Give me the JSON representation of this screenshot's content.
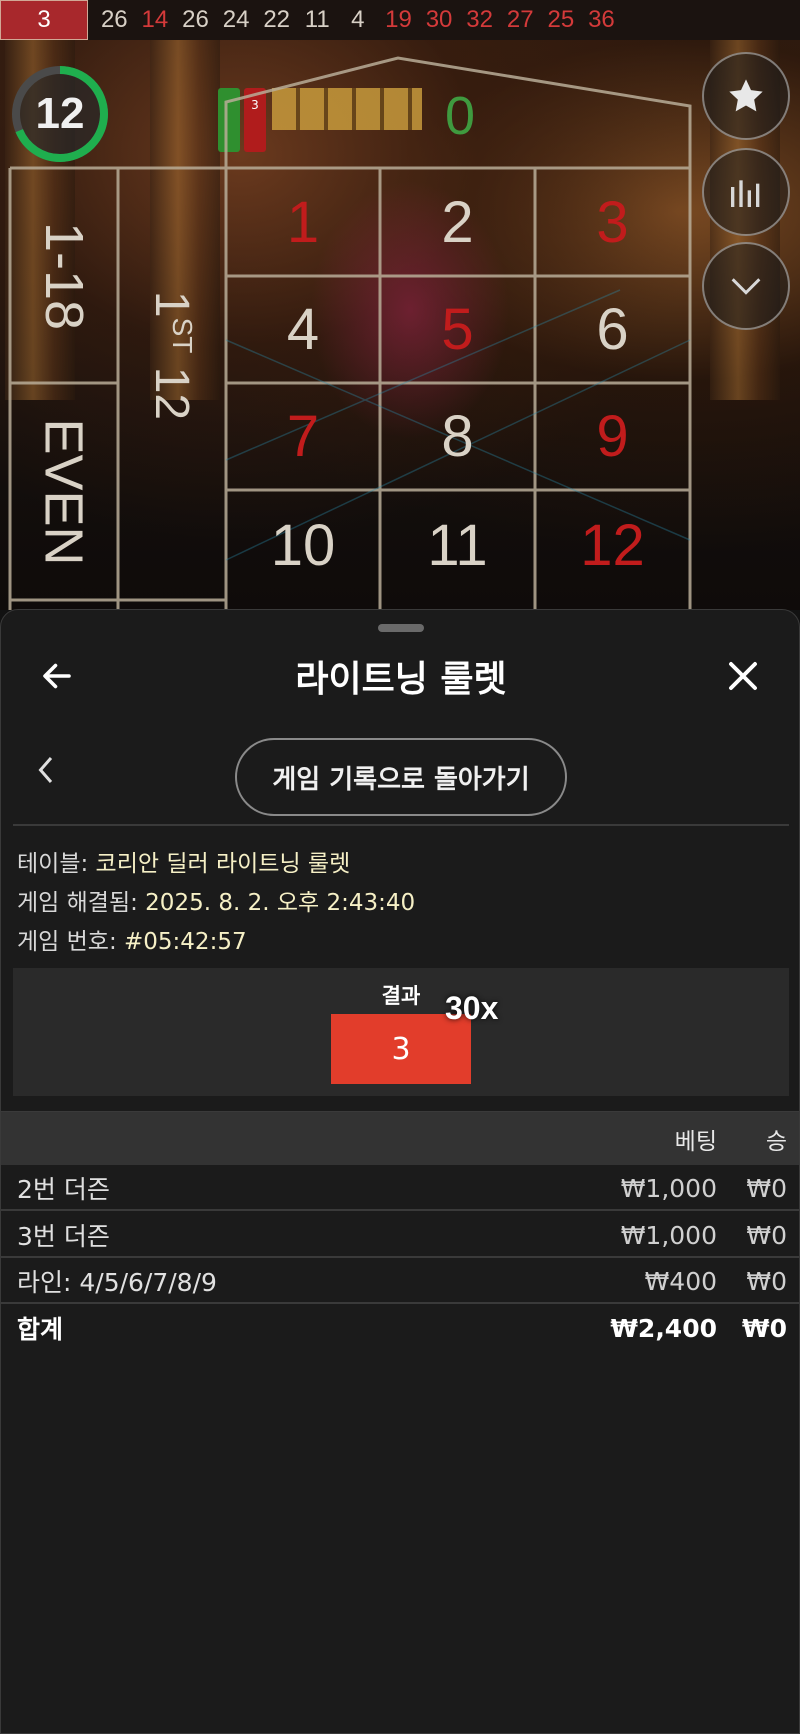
{
  "history": {
    "numbers": [
      {
        "value": "3",
        "color": "red"
      },
      {
        "value": "26",
        "color": "black"
      },
      {
        "value": "14",
        "color": "red"
      },
      {
        "value": "26",
        "color": "black"
      },
      {
        "value": "24",
        "color": "black"
      },
      {
        "value": "22",
        "color": "black"
      },
      {
        "value": "11",
        "color": "black"
      },
      {
        "value": "4",
        "color": "black"
      },
      {
        "value": "19",
        "color": "red"
      },
      {
        "value": "30",
        "color": "red"
      },
      {
        "value": "32",
        "color": "red"
      },
      {
        "value": "27",
        "color": "red"
      },
      {
        "value": "25",
        "color": "red"
      },
      {
        "value": "36",
        "color": "red"
      }
    ]
  },
  "game": {
    "timer": "12",
    "zero": "0",
    "mini_result": "3",
    "outside": {
      "low": "1-18",
      "even": "EVEN",
      "dozen_main": "1",
      "dozen_sup": "ST",
      "dozen_num": "12"
    },
    "grid": [
      [
        "1",
        "2",
        "3"
      ],
      [
        "4",
        "5",
        "6"
      ],
      [
        "7",
        "8",
        "9"
      ],
      [
        "10",
        "11",
        "12"
      ]
    ],
    "red_numbers": [
      "1",
      "3",
      "5",
      "7",
      "9",
      "12"
    ],
    "colors": {
      "red": "#c11c1c",
      "green": "#3f9a3f",
      "timer_ring": "#1fae4e"
    }
  },
  "sheet": {
    "title": "라이트닝 룰렛",
    "back_to_history": "게임 기록으로 돌아가기",
    "info": {
      "table_label": "테이블: ",
      "table_value": "코리안 딜러 라이트닝 룰렛",
      "resolved_label": "게임 해결됨: ",
      "resolved_value": "2025. 8. 2. 오후 2:43:40",
      "game_no_label": "게임 번호: ",
      "game_no_value": "#05:42:57"
    },
    "result": {
      "label": "결과",
      "number": "3",
      "multiplier": "30x",
      "color": "#e23d2b"
    },
    "table": {
      "headers": {
        "bet": "베팅",
        "win": "승"
      },
      "rows": [
        {
          "name": "2번 더즌",
          "bet": "₩1,000",
          "win": "₩0"
        },
        {
          "name": "3번 더즌",
          "bet": "₩1,000",
          "win": "₩0"
        },
        {
          "name": "라인: 4/5/6/7/8/9",
          "bet": "₩400",
          "win": "₩0"
        }
      ],
      "total": {
        "name": "합계",
        "bet": "₩2,400",
        "win": "₩0"
      }
    }
  }
}
